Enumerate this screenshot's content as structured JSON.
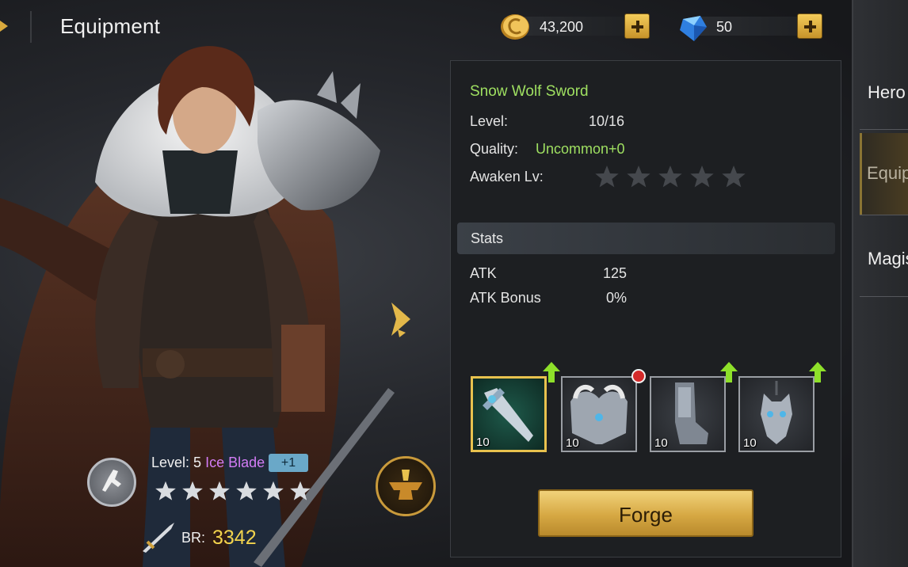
{
  "header": {
    "title": "Equipment"
  },
  "currencies": [
    {
      "icon": "gold-coin-icon",
      "value": "43,200"
    },
    {
      "icon": "blue-gem-icon",
      "value": "50"
    }
  ],
  "item": {
    "name": "Snow Wolf Sword",
    "level_label": "Level:",
    "level_value": "10/16",
    "quality_label": "Quality:",
    "quality_value": "Uncommon+0",
    "awaken_label": "Awaken Lv:",
    "awaken_stars": 0,
    "awaken_max": 5
  },
  "stats": {
    "header": "Stats",
    "rows": [
      {
        "label": "ATK",
        "value": "125"
      },
      {
        "label": "ATK Bonus",
        "value": "0%"
      }
    ]
  },
  "equipment_slots": [
    {
      "name": "sword",
      "level": "10",
      "selected": true,
      "upgrade_available": true,
      "notification": false
    },
    {
      "name": "armor",
      "level": "10",
      "selected": false,
      "upgrade_available": false,
      "notification": true
    },
    {
      "name": "boots",
      "level": "10",
      "selected": false,
      "upgrade_available": true,
      "notification": false
    },
    {
      "name": "amulet",
      "level": "10",
      "selected": false,
      "upgrade_available": true,
      "notification": false
    }
  ],
  "forge_button": {
    "label": "Forge"
  },
  "hero": {
    "level_prefix": "Level: 5",
    "class_name": "Ice Blade",
    "plus_badge": "+1",
    "stars": 6,
    "br_label": "BR:",
    "br_value": "3342"
  },
  "side_menu": [
    {
      "label": "Hero",
      "active": false
    },
    {
      "label": "Equipment",
      "active": true
    },
    {
      "label": "Magister",
      "active": false
    }
  ],
  "colors": {
    "item_name": "#9fe061",
    "hero_class": "#d27cf5",
    "br_value": "#f3d44d",
    "accent_gold": "#e8c24e"
  }
}
